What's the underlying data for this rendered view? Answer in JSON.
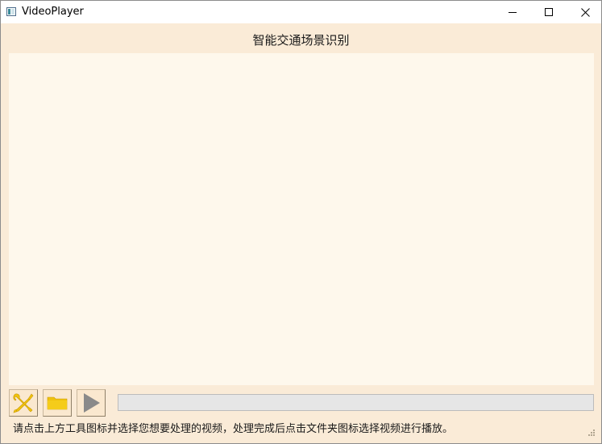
{
  "window": {
    "title": "VideoPlayer",
    "controls": {
      "minimize_icon": "minimize-icon",
      "maximize_icon": "maximize-icon",
      "close_icon": "close-icon"
    }
  },
  "header": {
    "title": "智能交通场景识别"
  },
  "toolbar": {
    "buttons": [
      {
        "icon": "tools-icon",
        "color": "#f0c20e"
      },
      {
        "icon": "folder-icon",
        "color": "#f0c20e"
      },
      {
        "icon": "play-icon",
        "color": "#8a8a8a"
      }
    ]
  },
  "progress": {
    "value": 0
  },
  "status": {
    "text": "请点击上方工具图标并选择您想要处理的视频，处理完成后点击文件夹图标选择视频进行播放。"
  },
  "colors": {
    "background": "#faebd7",
    "video_area": "#fef8ec",
    "icon_yellow": "#f0c20e",
    "icon_gray": "#8a8a8a"
  }
}
